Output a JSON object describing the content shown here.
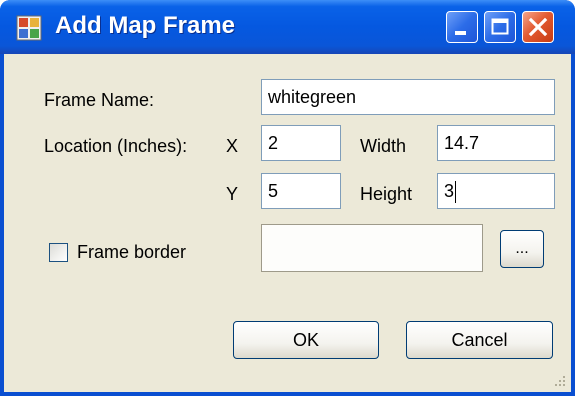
{
  "window": {
    "title": "Add Map Frame",
    "app_icon": "map-frame-icon",
    "controls": {
      "minimize_icon": "minimize-icon",
      "maximize_icon": "maximize-icon",
      "close_icon": "close-icon"
    }
  },
  "form": {
    "frame_name_label": "Frame Name:",
    "frame_name_value": "whitegreen",
    "location_label": "Location (Inches):",
    "x_label": "X",
    "x_value": "2",
    "y_label": "Y",
    "y_value": "5",
    "width_label": "Width",
    "width_value": "14.7",
    "height_label": "Height",
    "height_value": "3",
    "frame_border_label": "Frame border",
    "frame_border_checked": false,
    "frame_border_value": "",
    "browse_label": "..."
  },
  "buttons": {
    "ok_label": "OK",
    "cancel_label": "Cancel"
  },
  "colors": {
    "titlebar": "#0558e0",
    "client_background": "#ece9d8",
    "close_button": "#e35b32",
    "textbox_border": "#7f9db9"
  }
}
